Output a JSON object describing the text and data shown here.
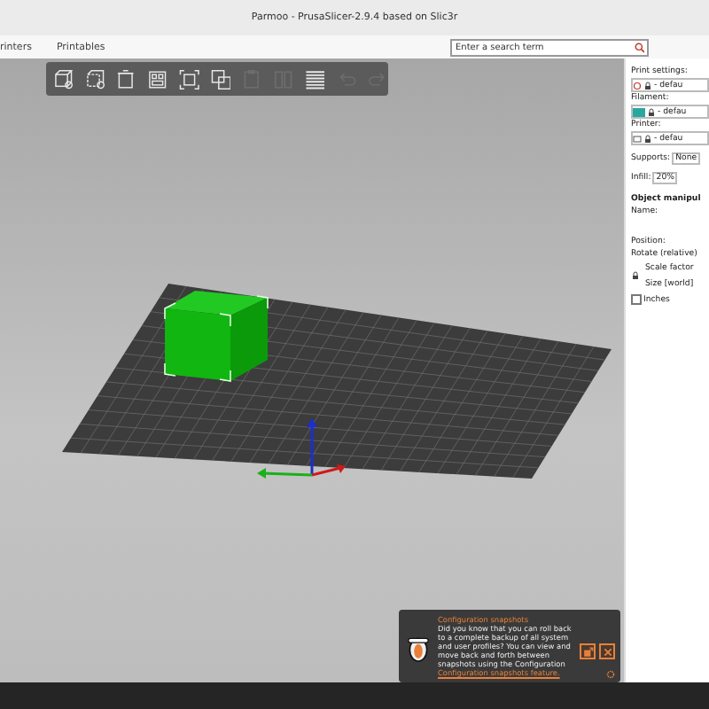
{
  "window": {
    "title": "Parmoo - PrusaSlicer-2.9.4 based on Slic3r"
  },
  "tabs": [
    {
      "label": "rinters"
    },
    {
      "label": "Printables"
    }
  ],
  "search": {
    "placeholder": "Enter a search term"
  },
  "toolbar": [
    {
      "kind": "add",
      "disabled": false
    },
    {
      "kind": "delete",
      "disabled": false
    },
    {
      "kind": "delete_all",
      "disabled": false
    },
    {
      "kind": "arrange",
      "disabled": false
    },
    {
      "kind": "select",
      "disabled": false
    },
    {
      "kind": "copy",
      "disabled": false
    },
    {
      "kind": "paste",
      "disabled": true
    },
    {
      "kind": "split",
      "disabled": true
    },
    {
      "kind": "layers",
      "disabled": false
    },
    {
      "kind": "undo",
      "disabled": true
    },
    {
      "kind": "redo",
      "disabled": true
    }
  ],
  "sidebar": {
    "presets": [
      {
        "label": "Print settings:",
        "value": "- defau",
        "kind": "print"
      },
      {
        "label": "Filament:",
        "value": "- defau",
        "kind": "filament",
        "color": "#2aa6a0"
      },
      {
        "label": "Printer:",
        "value": "- defau",
        "kind": "printer"
      }
    ],
    "supports": {
      "label": "Supports:",
      "value": "None"
    },
    "infill": {
      "label": "Infill:",
      "value": "20%"
    },
    "manipulation": {
      "title": "Object manipul",
      "name_label": "Name:",
      "position_label": "Position:",
      "rotate_label": "Rotate (relative)",
      "scale_label": "Scale factor",
      "size_label": "Size [world]",
      "inches": {
        "label": "Inches",
        "checked": false
      }
    }
  },
  "notification": {
    "title": "Configuration snapshots",
    "body": "Did you know that you can roll back to a complete backup of all system and user profiles? You can view and move back and forth between snapshots using the Configuration",
    "link": "Configuration snapshots feature."
  }
}
